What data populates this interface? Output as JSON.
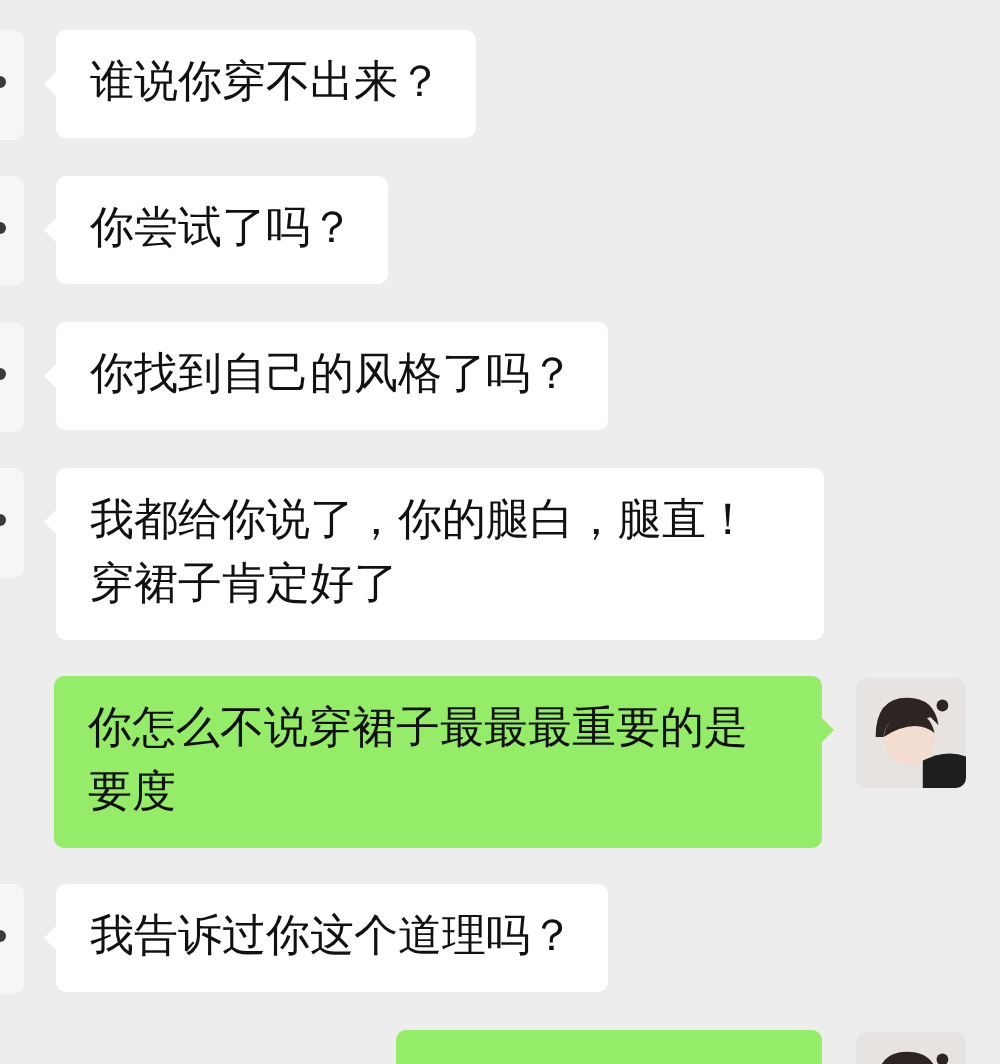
{
  "messages": [
    {
      "kind": "incoming",
      "text": "谁说你穿不出来？"
    },
    {
      "kind": "incoming",
      "text": "你尝试了吗？"
    },
    {
      "kind": "incoming",
      "text": "你找到自己的风格了吗？"
    },
    {
      "kind": "incoming",
      "text": "我都给你说了，你的腿白，腿直！穿裙子肯定好了"
    },
    {
      "kind": "outgoing",
      "text": "你怎么不说穿裙子最最最重要的是要度"
    },
    {
      "kind": "incoming",
      "text": "我告诉过你这个道理吗？"
    },
    {
      "kind": "outgoing"
    }
  ]
}
